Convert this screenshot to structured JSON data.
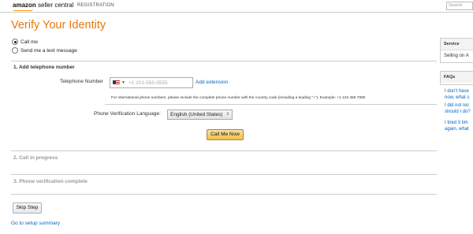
{
  "header": {
    "brand_bold": "amazon",
    "brand_rest": " seller central",
    "registration": "REGISTRATION",
    "search_placeholder": "Search"
  },
  "page": {
    "title": "Verify Your Identity"
  },
  "method": {
    "options": [
      {
        "label": "Call me",
        "checked": true
      },
      {
        "label": "Send me a text message",
        "checked": false
      }
    ]
  },
  "step1": {
    "heading": "1. Add telephone number",
    "phone_label": "Telephone Number",
    "phone_placeholder": "+1 201-555-5555",
    "country_flag": "us-flag-icon",
    "add_extension": "Add extension",
    "hint": "For international phone numbers, please include the complete phone number with the country code (including a leading \"+\"). Example: +1 123 456 7890",
    "language_label": "Phone Verification Language:",
    "language_value": "English (United States)",
    "call_button": "Call Me Now"
  },
  "step2": {
    "heading": "2. Call in progress"
  },
  "step3": {
    "heading": "3. Phone verification complete"
  },
  "footer": {
    "skip_button": "Skip Step",
    "setup_link": "Go to setup summary"
  },
  "sidebar": {
    "service_heading": "Service",
    "service_text": "Selling on A",
    "faqs_heading": "FAQs",
    "faq_links": [
      [
        "I don't have",
        "now, what s"
      ],
      [
        "I did not rec",
        "should I do?"
      ],
      [
        "I tried 3 tim",
        "again, what"
      ]
    ]
  },
  "colors": {
    "title": "#e47911",
    "link": "#0066c0",
    "call_button": "#f0c14b"
  }
}
